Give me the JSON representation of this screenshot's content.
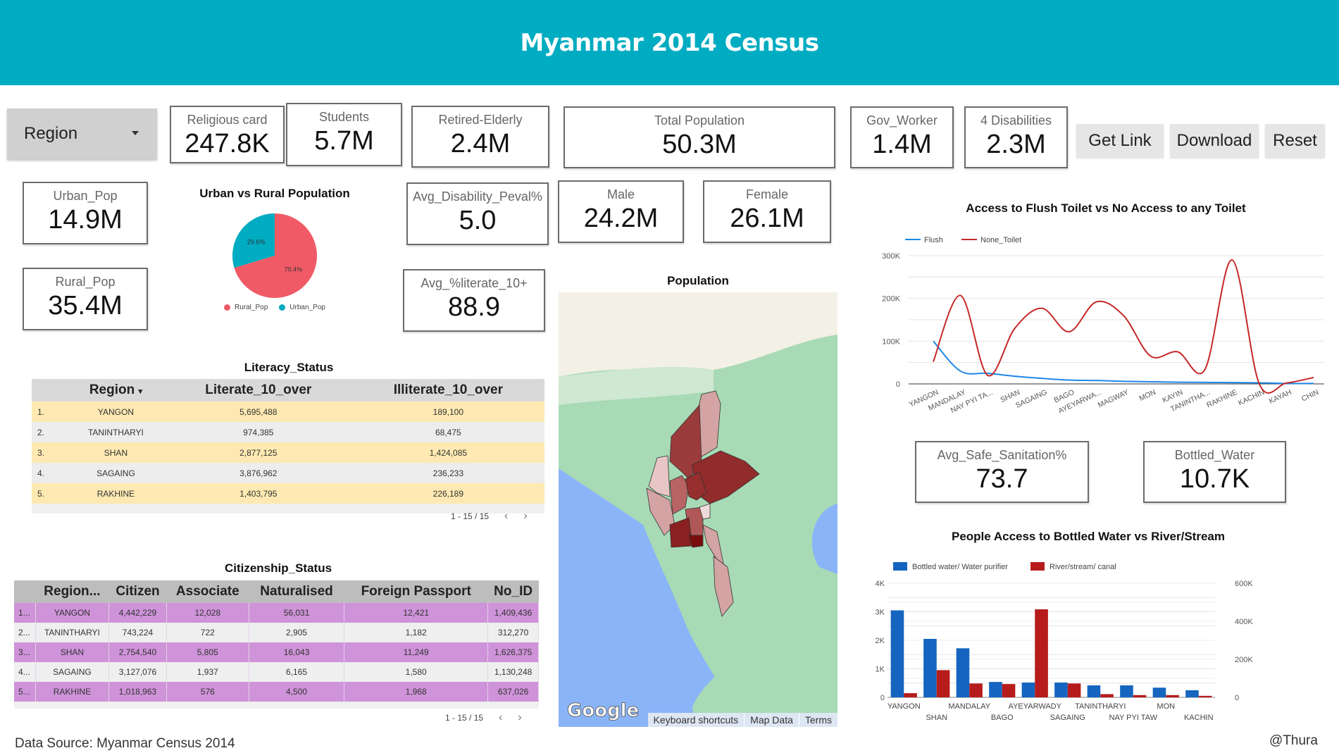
{
  "header": {
    "title": "Myanmar 2014 Census",
    "bg_color": "#00acc1"
  },
  "controls": {
    "region_filter": "Region",
    "get_link": "Get Link",
    "download": "Download",
    "reset": "Reset"
  },
  "kpis": {
    "religious_card": {
      "label": "Religious card",
      "value": "247.8K"
    },
    "students": {
      "label": "Students",
      "value": "5.7M"
    },
    "retired_elderly": {
      "label": "Retired-Elderly",
      "value": "2.4M"
    },
    "total_population": {
      "label": "Total Population",
      "value": "50.3M"
    },
    "gov_worker": {
      "label": "Gov_Worker",
      "value": "1.4M"
    },
    "disabilities": {
      "label": "4 Disabilities",
      "value": "2.3M"
    },
    "urban_pop": {
      "label": "Urban_Pop",
      "value": "14.9M"
    },
    "rural_pop": {
      "label": "Rural_Pop",
      "value": "35.4M"
    },
    "avg_disability": {
      "label": "Avg_Disability_Peval%",
      "value": "5.0"
    },
    "avg_literate": {
      "label": "Avg_%literate_10+",
      "value": "88.9"
    },
    "male": {
      "label": "Male",
      "value": "24.2M"
    },
    "female": {
      "label": "Female",
      "value": "26.1M"
    },
    "avg_safe_sanitation": {
      "label": "Avg_Safe_Sanitation%",
      "value": "73.7"
    },
    "bottled_water": {
      "label": "Bottled_Water",
      "value": "10.7K"
    }
  },
  "literacy": {
    "title": "Literacy_Status",
    "columns": [
      "Region",
      "Literate_10_over",
      "Illiterate_10_over"
    ],
    "rows": [
      {
        "idx": "1.",
        "region": "YANGON",
        "lit": "5,695,488",
        "illit": "189,100"
      },
      {
        "idx": "2.",
        "region": "TANINTHARYI",
        "lit": "974,385",
        "illit": "68,475"
      },
      {
        "idx": "3.",
        "region": "SHAN",
        "lit": "2,877,125",
        "illit": "1,424,085"
      },
      {
        "idx": "4.",
        "region": "SAGAING",
        "lit": "3,876,962",
        "illit": "236,233"
      },
      {
        "idx": "5.",
        "region": "RAKHINE",
        "lit": "1,403,795",
        "illit": "226,189"
      }
    ],
    "pager": "1 - 15 / 15",
    "prev": "‹",
    "next": "›"
  },
  "citizenship": {
    "title": "Citizenship_Status",
    "columns": [
      "Region...",
      "Citizen",
      "Associate",
      "Naturalised",
      "Foreign Passport",
      "No_ID"
    ],
    "rows": [
      {
        "idx": "1...",
        "region": "YANGON",
        "citizen": "4,442,229",
        "associate": "12,028",
        "naturalised": "56,031",
        "foreign": "12,421",
        "noid": "1,409,436"
      },
      {
        "idx": "2...",
        "region": "TANINTHARYI",
        "citizen": "743,224",
        "associate": "722",
        "naturalised": "2,905",
        "foreign": "1,182",
        "noid": "312,270"
      },
      {
        "idx": "3...",
        "region": "SHAN",
        "citizen": "2,754,540",
        "associate": "5,805",
        "naturalised": "16,043",
        "foreign": "11,249",
        "noid": "1,626,375"
      },
      {
        "idx": "4...",
        "region": "SAGAING",
        "citizen": "3,127,076",
        "associate": "1,937",
        "naturalised": "6,165",
        "foreign": "1,580",
        "noid": "1,130,248"
      },
      {
        "idx": "5...",
        "region": "RAKHINE",
        "citizen": "1,018,963",
        "associate": "576",
        "naturalised": "4,500",
        "foreign": "1,968",
        "noid": "637,026"
      }
    ],
    "pager": "1 - 15 / 15",
    "prev": "‹",
    "next": "›"
  },
  "map": {
    "title": "Population",
    "attribution": {
      "logo": "Google",
      "keyboard": "Keyboard shortcuts",
      "map_data": "Map Data",
      "terms": "Terms"
    }
  },
  "footer": {
    "source": "Data Source: Myanmar Census 2014",
    "author": "@Thura"
  },
  "chart_data": [
    {
      "type": "pie",
      "title": "Urban vs Rural Population",
      "categories": [
        "Rural_Pop",
        "Urban_Pop"
      ],
      "values": [
        70.4,
        29.6
      ],
      "labels": [
        "70.4%",
        "29.6%"
      ],
      "colors": [
        "#f05a66",
        "#00acc1"
      ],
      "legend": "bottom"
    },
    {
      "type": "line",
      "title": "Access to Flush Toilet vs No Access to any Toilet",
      "categories": [
        "YANGON",
        "MANDALAY",
        "NAY PYI TA...",
        "SHAN",
        "SAGAING",
        "BAGO",
        "AYEYARWA...",
        "MAGWAY",
        "MON",
        "KAYIN",
        "TANINTHA...",
        "RAKHINE",
        "KACHIN",
        "KAYAH",
        "CHIN"
      ],
      "series": [
        {
          "name": "Flush",
          "color": "#1e88e5",
          "values": [
            100000,
            30000,
            25000,
            18000,
            13000,
            9000,
            8000,
            6000,
            5000,
            4000,
            3500,
            3000,
            2500,
            1000,
            1000
          ]
        },
        {
          "name": "None_Toilet",
          "color": "#c62828",
          "values": [
            52000,
            207000,
            20000,
            130000,
            177000,
            122000,
            192000,
            160000,
            65000,
            75000,
            34000,
            290000,
            0,
            2000,
            15000
          ]
        }
      ],
      "ylim": [
        0,
        300000
      ],
      "yticks": [
        "0",
        "100K",
        "200K",
        "300K"
      ],
      "legend": "top-left",
      "grid": true
    },
    {
      "type": "bar",
      "title": "People Access to Bottled Water vs River/Stream",
      "categories": [
        "YANGON",
        "SHAN",
        "MANDALAY",
        "BAGO",
        "AYEYARWADY",
        "SAGAING",
        "TANINTHARYI",
        "NAY PYI TAW",
        "MON",
        "KACHIN"
      ],
      "series": [
        {
          "name": "Bottled water/ Water purifier",
          "color": "#1565c0",
          "axis": "left",
          "values": [
            3050,
            2050,
            1720,
            540,
            520,
            520,
            420,
            420,
            340,
            250
          ]
        },
        {
          "name": "River/stream/ canal",
          "color": "#b71c1c",
          "axis": "right",
          "values": [
            22000,
            143000,
            73000,
            70000,
            463000,
            73000,
            17000,
            12000,
            12000,
            8000
          ]
        }
      ],
      "ylim_left": [
        0,
        4000
      ],
      "ylim_right": [
        0,
        600000
      ],
      "yticks_left": [
        "0",
        "1K",
        "2K",
        "3K",
        "4K"
      ],
      "yticks_right": [
        "0",
        "200K",
        "400K",
        "600K"
      ],
      "legend": "top-left",
      "grid": true
    }
  ]
}
